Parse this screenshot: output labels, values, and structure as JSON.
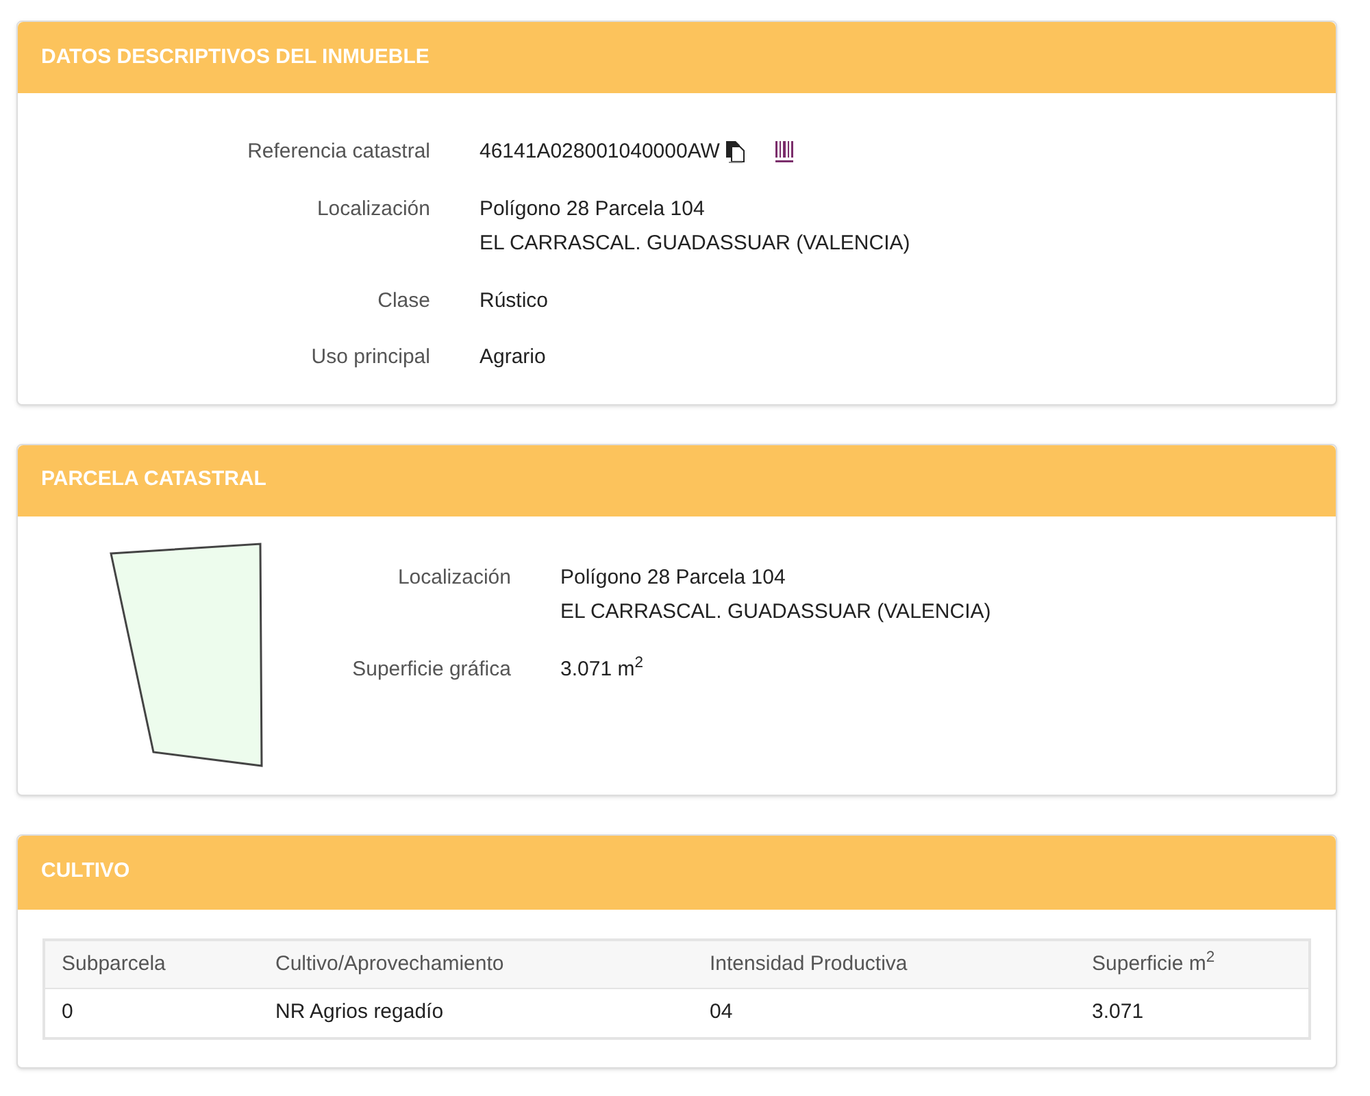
{
  "inmueble": {
    "title": "DATOS DESCRIPTIVOS DEL INMUEBLE",
    "fields": [
      {
        "label": "Referencia catastral",
        "lines": [
          "46141A028001040000AW"
        ],
        "kind": "reference"
      },
      {
        "label": "Localización",
        "lines": [
          "Polígono 28 Parcela 104",
          "EL CARRASCAL. GUADASSUAR (VALENCIA)"
        ],
        "kind": "text"
      },
      {
        "label": "Clase",
        "lines": [
          "Rústico"
        ],
        "kind": "text"
      },
      {
        "label": "Uso principal",
        "lines": [
          "Agrario"
        ],
        "kind": "text"
      }
    ]
  },
  "parcela": {
    "title": "PARCELA CATASTRAL",
    "fields": [
      {
        "label": "Localización",
        "lines": [
          "Polígono 28 Parcela 104",
          "EL CARRASCAL. GUADASSUAR (VALENCIA)"
        ]
      },
      {
        "label": "Superficie gráfica",
        "lines": [
          "3.071 m$^{2}$"
        ]
      }
    ]
  },
  "cultivo": {
    "title": "CULTIVO",
    "table": {
      "columns": [
        "Subparcela",
        "Cultivo/Aprovechamiento",
        "Intensidad Productiva",
        "Superficie m$^{2}$"
      ],
      "rows": [
        [
          "0",
          "NR Agrios regadío",
          "04",
          "3.071"
        ]
      ]
    }
  }
}
